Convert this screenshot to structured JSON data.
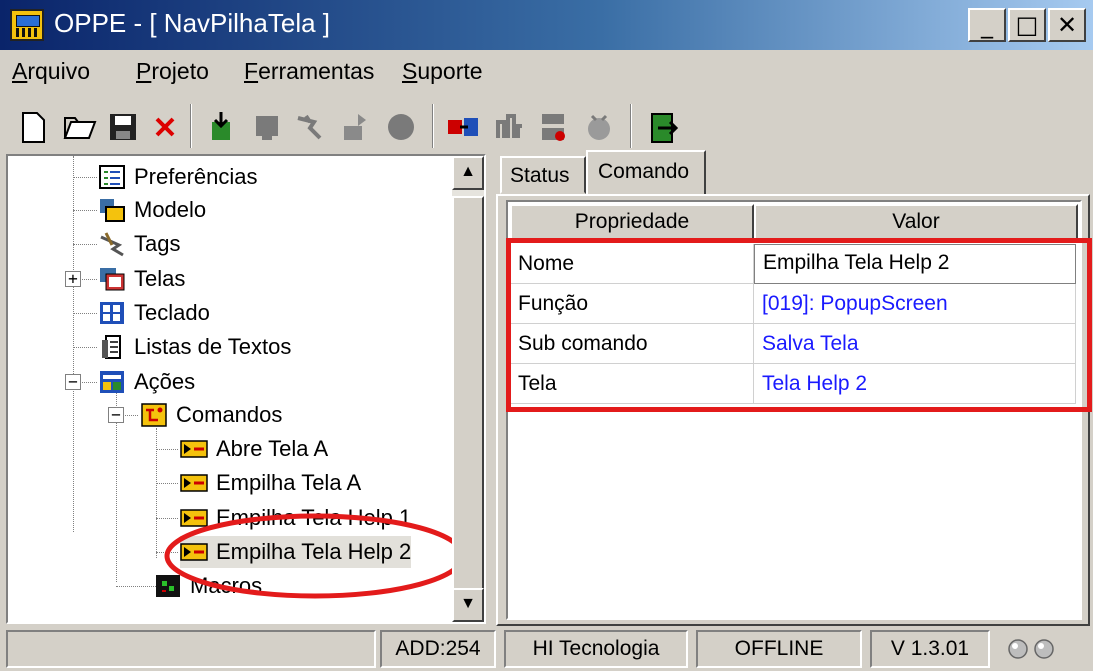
{
  "window": {
    "title": "OPPE - [ NavPilhaTela ]",
    "minimize": "_",
    "maximize": "□",
    "close": "✕"
  },
  "menu": [
    {
      "first": "A",
      "rest": "rquivo"
    },
    {
      "first": "P",
      "rest": "rojeto"
    },
    {
      "first": "F",
      "rest": "erramentas"
    },
    {
      "first": "S",
      "rest": "uporte"
    }
  ],
  "toolbar": {
    "icons": [
      "new-file-icon",
      "open-folder-icon",
      "save-icon",
      "delete-icon",
      "import-icon",
      "screen-icon",
      "tag-icon",
      "export-icon",
      "record-icon",
      "connect-icon",
      "transfer-icon",
      "settings-icon",
      "clear-icon",
      "exit-icon"
    ]
  },
  "tree": {
    "items": [
      {
        "label": "Preferências",
        "icon": "preferences-icon"
      },
      {
        "label": "Modelo",
        "icon": "model-icon"
      },
      {
        "label": "Tags",
        "icon": "tags-icon"
      },
      {
        "label": "Telas",
        "icon": "screens-icon",
        "expander": "+"
      },
      {
        "label": "Teclado",
        "icon": "keyboard-icon"
      },
      {
        "label": "Listas de Textos",
        "icon": "text-list-icon"
      },
      {
        "label": "Ações",
        "icon": "actions-icon",
        "expander": "−"
      },
      {
        "label": "Comandos",
        "icon": "commands-icon",
        "expander": "−"
      },
      {
        "label": "Abre Tela A",
        "icon": "command-icon"
      },
      {
        "label": "Empilha Tela A",
        "icon": "command-icon"
      },
      {
        "label": "Empilha Tela Help 1",
        "icon": "command-icon"
      },
      {
        "label": "Empilha Tela Help 2",
        "icon": "command-icon",
        "selected": true
      },
      {
        "label": "Macros",
        "icon": "macros-icon"
      }
    ],
    "scroll_up": "▲",
    "scroll_down": "▼"
  },
  "tabs": [
    {
      "label": "Status",
      "active": false
    },
    {
      "label": "Comando",
      "active": true
    }
  ],
  "grid": {
    "headers": [
      "Propriedade",
      "Valor"
    ],
    "rows": [
      {
        "prop": "Nome",
        "value": "Empilha Tela Help 2"
      },
      {
        "prop": "Função",
        "value": "[019]: PopupScreen"
      },
      {
        "prop": "Sub comando",
        "value": "Salva Tela"
      },
      {
        "prop": "Tela",
        "value": "Tela Help 2"
      }
    ]
  },
  "status_bar": {
    "address": "ADD:254",
    "company": "HI Tecnologia",
    "connection": "OFFLINE",
    "version": "V 1.3.01"
  },
  "colors": {
    "annotation": "#e31b1b",
    "link_value": "#1a1aff",
    "title_bar": "#0a246a"
  }
}
